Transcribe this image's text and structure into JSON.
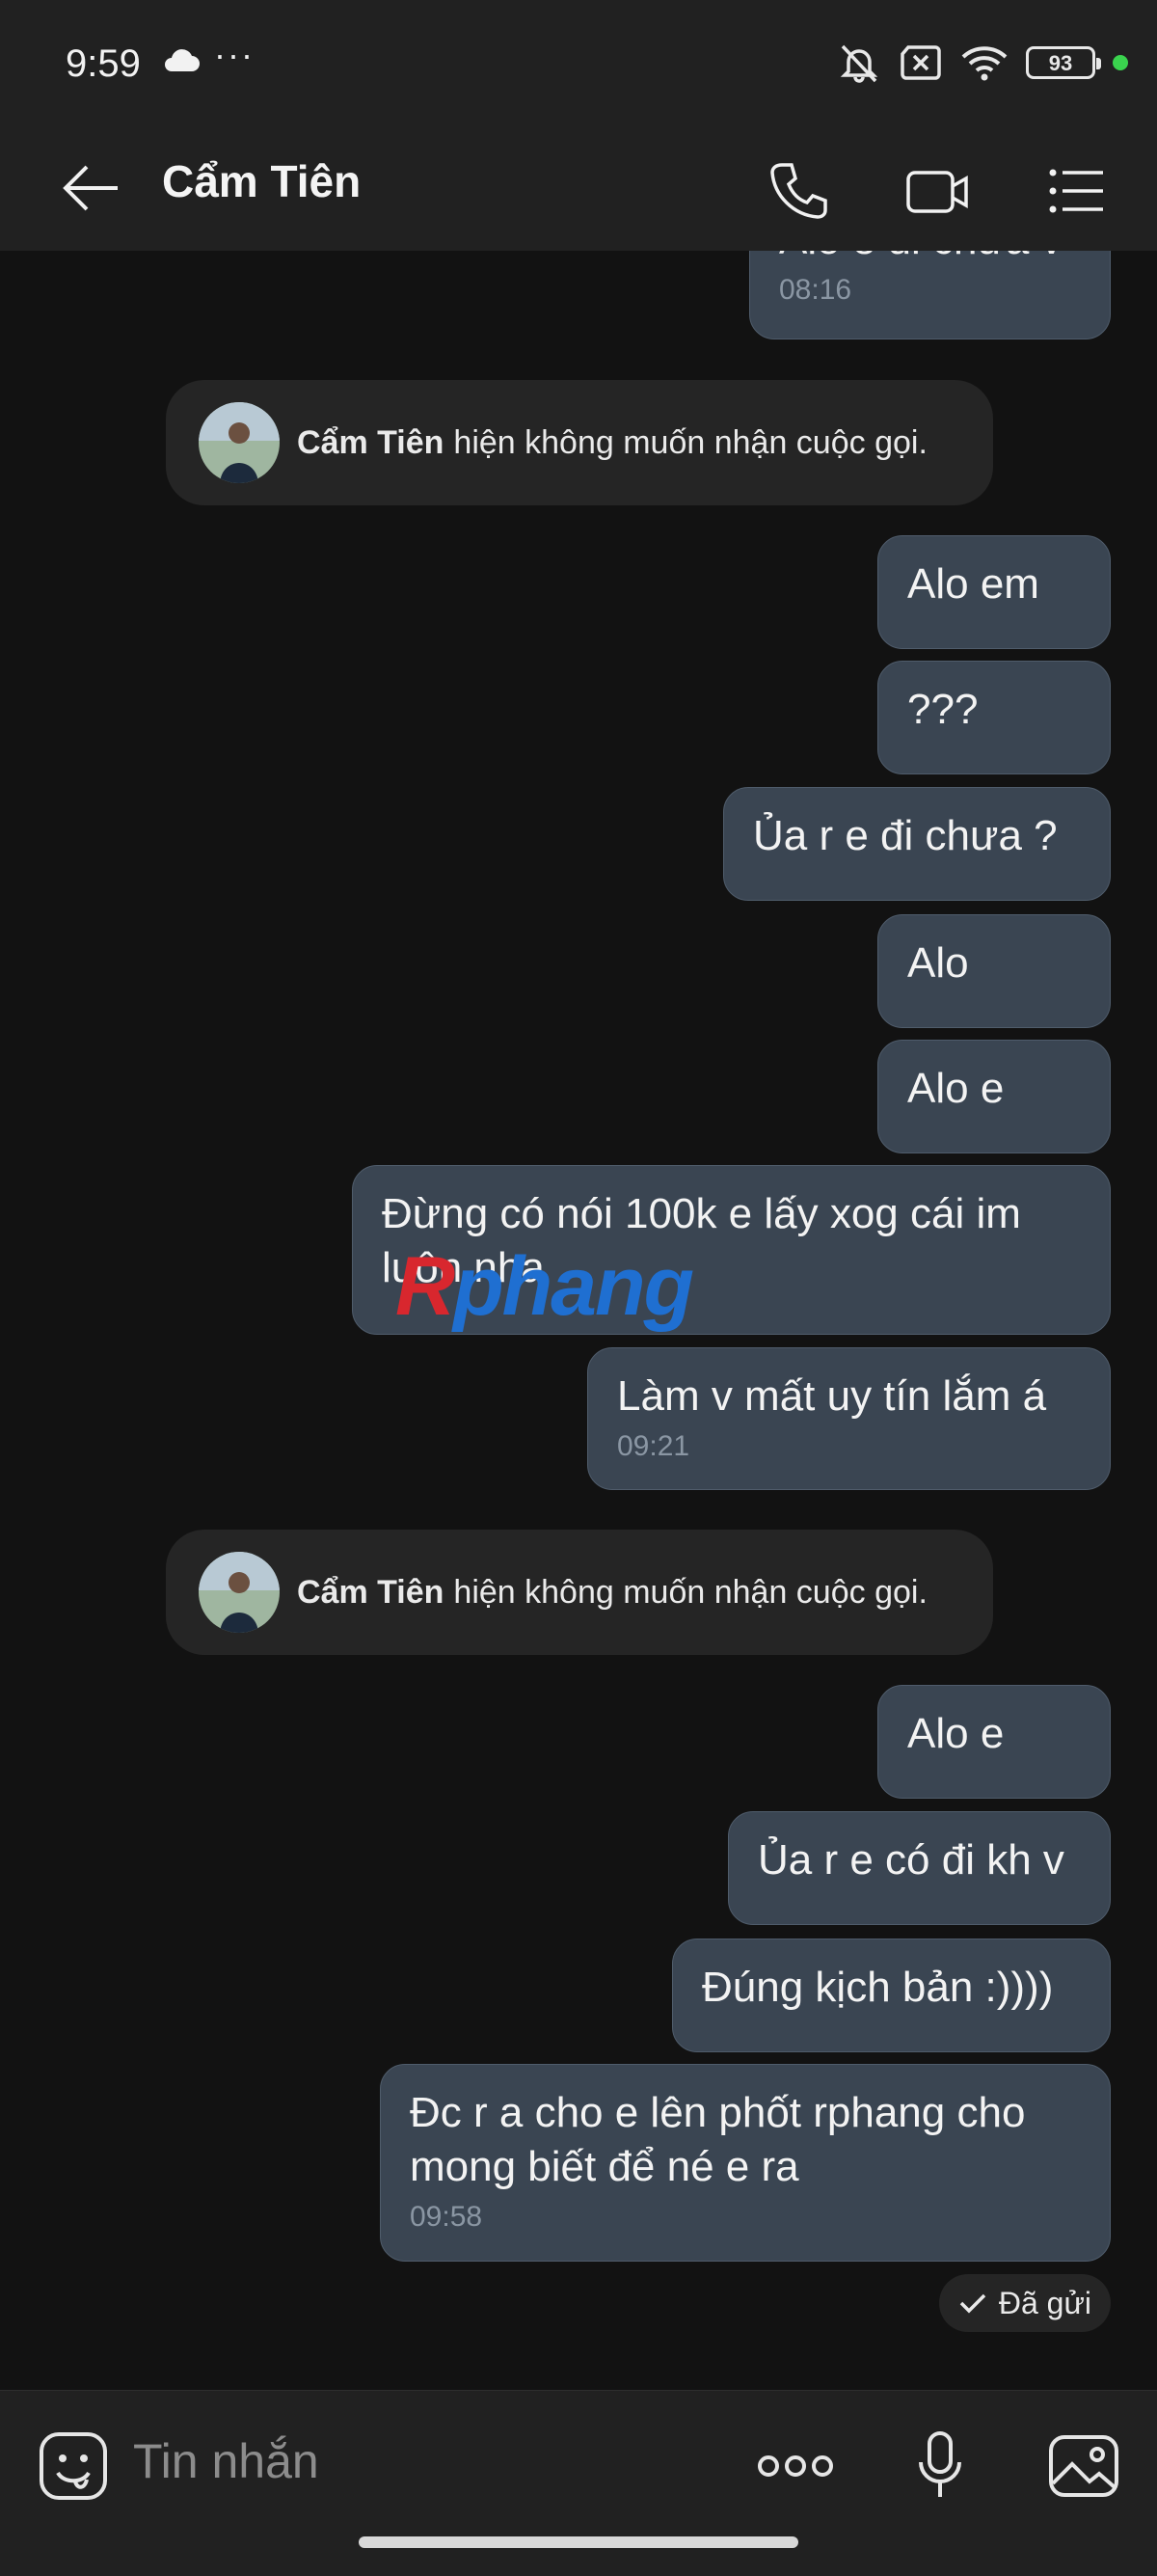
{
  "status_bar": {
    "time": "9:59",
    "battery": "93",
    "icons": [
      "cloud-icon",
      "more-dots-icon",
      "mute-icon",
      "no-sim-icon",
      "wifi-icon",
      "battery-icon"
    ]
  },
  "header": {
    "title": "Cẩm Tiên",
    "icons": [
      "back-arrow-icon",
      "phone-icon",
      "video-call-icon",
      "menu-list-icon"
    ]
  },
  "messages": [
    {
      "text": "Alo e đi chưa v",
      "time": "08:16"
    },
    {
      "text": "Alo em"
    },
    {
      "text": "???"
    },
    {
      "text": "Ủa r e đi chưa ?"
    },
    {
      "text": "Alo"
    },
    {
      "text": "Alo e"
    },
    {
      "text": "Đừng có nói 100k e lấy xog cái im luôn nha"
    },
    {
      "text": "Làm v mất uy tín lắm á",
      "time": "09:21"
    },
    {
      "text": "Alo e"
    },
    {
      "text": "Ủa r e có đi kh v"
    },
    {
      "text": "Đúng kịch bản :))))"
    },
    {
      "text": "Đc r a cho e lên phốt rphang cho mong biết để né e ra",
      "time": "09:58"
    }
  ],
  "system_notices": [
    {
      "name": "Cẩm Tiên",
      "text": "hiện không muốn nhận cuộc gọi."
    },
    {
      "name": "Cẩm Tiên",
      "text": "hiện không muốn nhận cuộc gọi."
    }
  ],
  "sent_status": "Đã gửi",
  "watermark": {
    "first": "R",
    "rest": "phang"
  },
  "input_bar": {
    "placeholder": "Tin nhắn",
    "icons": [
      "sticker-icon",
      "more-options-icon",
      "microphone-icon",
      "image-icon"
    ]
  },
  "colors": {
    "background": "#121212",
    "bar": "#212121",
    "bubble": "#3a4552",
    "system_pill": "#252525",
    "online_dot": "#3ad34e"
  }
}
